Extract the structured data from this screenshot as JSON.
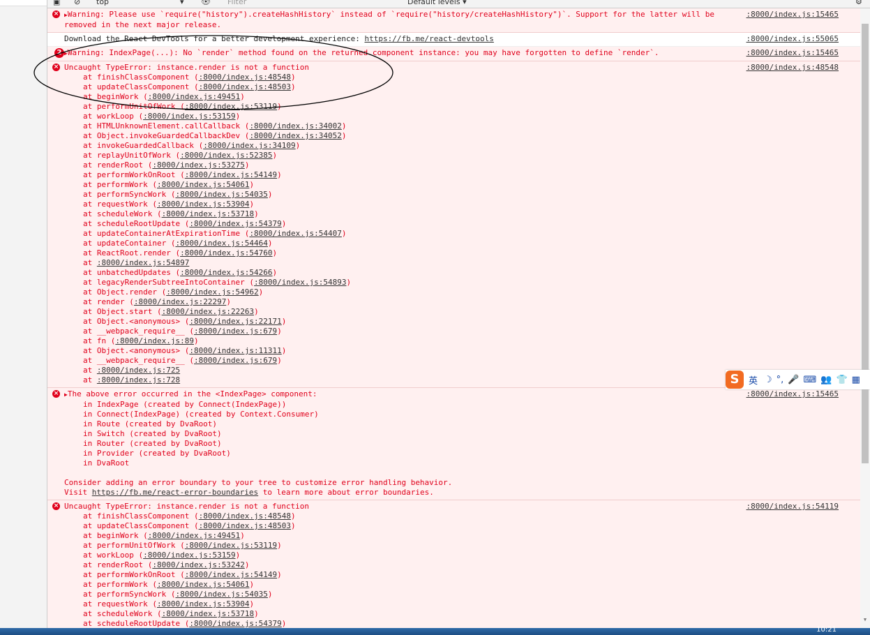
{
  "toolbar": {
    "context": "top",
    "filter_placeholder": "Filter",
    "levels_label": "Default levels ▾"
  },
  "messages": [
    {
      "type": "err",
      "kind": "warning",
      "text": "Warning: Please use `require(\"history\").createHashHistory` instead of `require(\"history/createHashHistory\")`. Support for the latter will be\nremoved in the next major release.",
      "source": ":8000/index.js:15465"
    },
    {
      "type": "plain",
      "text": "Download the React DevTools for a better development experience: ",
      "link": "https://fb.me/react-devtools",
      "source": ":8000/index.js:55065"
    },
    {
      "type": "err",
      "kind": "warning",
      "count": "2",
      "text": "Warning: IndexPage(...): No `render` method found on the returned component instance: you may have forgotten to define `render`.",
      "source": ":8000/index.js:15465"
    },
    {
      "type": "err",
      "kind": "error",
      "text": "Uncaught TypeError: instance.render is not a function",
      "source": ":8000/index.js:48548",
      "stack": [
        [
          "finishClassComponent",
          ":8000/index.js:48548"
        ],
        [
          "updateClassComponent",
          ":8000/index.js:48503"
        ],
        [
          "beginWork",
          ":8000/index.js:49451"
        ],
        [
          "performUnitOfWork",
          ":8000/index.js:53119"
        ],
        [
          "workLoop",
          ":8000/index.js:53159"
        ],
        [
          "HTMLUnknownElement.callCallback",
          ":8000/index.js:34002"
        ],
        [
          "Object.invokeGuardedCallbackDev",
          ":8000/index.js:34052"
        ],
        [
          "invokeGuardedCallback",
          ":8000/index.js:34109"
        ],
        [
          "replayUnitOfWork",
          ":8000/index.js:52385"
        ],
        [
          "renderRoot",
          ":8000/index.js:53275"
        ],
        [
          "performWorkOnRoot",
          ":8000/index.js:54149"
        ],
        [
          "performWork",
          ":8000/index.js:54061"
        ],
        [
          "performSyncWork",
          ":8000/index.js:54035"
        ],
        [
          "requestWork",
          ":8000/index.js:53904"
        ],
        [
          "scheduleWork",
          ":8000/index.js:53718"
        ],
        [
          "scheduleRootUpdate",
          ":8000/index.js:54379"
        ],
        [
          "updateContainerAtExpirationTime",
          ":8000/index.js:54407"
        ],
        [
          "updateContainer",
          ":8000/index.js:54464"
        ],
        [
          "ReactRoot.render",
          ":8000/index.js:54760"
        ],
        [
          "",
          ":8000/index.js:54897"
        ],
        [
          "unbatchedUpdates",
          ":8000/index.js:54266"
        ],
        [
          "legacyRenderSubtreeIntoContainer",
          ":8000/index.js:54893"
        ],
        [
          "Object.render",
          ":8000/index.js:54962"
        ],
        [
          "render",
          ":8000/index.js:22297"
        ],
        [
          "Object.start",
          ":8000/index.js:22263"
        ],
        [
          "Object.<anonymous>",
          ":8000/index.js:22171"
        ],
        [
          "__webpack_require__",
          ":8000/index.js:679"
        ],
        [
          "fn",
          ":8000/index.js:89"
        ],
        [
          "Object.<anonymous>",
          ":8000/index.js:11311"
        ],
        [
          "__webpack_require__",
          ":8000/index.js:679"
        ],
        [
          "",
          ":8000/index.js:725"
        ],
        [
          "",
          ":8000/index.js:728"
        ]
      ]
    },
    {
      "type": "err",
      "kind": "warning",
      "text": "The above error occurred in the <IndexPage> component:",
      "source": ":8000/index.js:15465",
      "component_stack": [
        "in IndexPage (created by Connect(IndexPage))",
        "in Connect(IndexPage) (created by Context.Consumer)",
        "in Route (created by DvaRoot)",
        "in Switch (created by DvaRoot)",
        "in Router (created by DvaRoot)",
        "in Provider (created by DvaRoot)",
        "in DvaRoot"
      ],
      "footer_1": "Consider adding an error boundary to your tree to customize error handling behavior.",
      "footer_2_pre": "Visit ",
      "footer_2_link": "https://fb.me/react-error-boundaries",
      "footer_2_post": " to learn more about error boundaries."
    },
    {
      "type": "err",
      "kind": "error",
      "text": "Uncaught TypeError: instance.render is not a function",
      "source": ":8000/index.js:54119",
      "stack": [
        [
          "finishClassComponent",
          ":8000/index.js:48548"
        ],
        [
          "updateClassComponent",
          ":8000/index.js:48503"
        ],
        [
          "beginWork",
          ":8000/index.js:49451"
        ],
        [
          "performUnitOfWork",
          ":8000/index.js:53119"
        ],
        [
          "workLoop",
          ":8000/index.js:53159"
        ],
        [
          "renderRoot",
          ":8000/index.js:53242"
        ],
        [
          "performWorkOnRoot",
          ":8000/index.js:54149"
        ],
        [
          "performWork",
          ":8000/index.js:54061"
        ],
        [
          "performSyncWork",
          ":8000/index.js:54035"
        ],
        [
          "requestWork",
          ":8000/index.js:53904"
        ],
        [
          "scheduleWork",
          ":8000/index.js:53718"
        ],
        [
          "scheduleRootUpdate",
          ":8000/index.js:54379"
        ]
      ]
    }
  ],
  "ime": {
    "lang": "英",
    "items": [
      "☽",
      "°,",
      "🎤",
      "⌨",
      "👥",
      "👕",
      "▦"
    ]
  },
  "taskbar": {
    "clock": "10:21"
  },
  "colors": {
    "error": "#e0001b",
    "error_bg": "#fff0f0"
  }
}
